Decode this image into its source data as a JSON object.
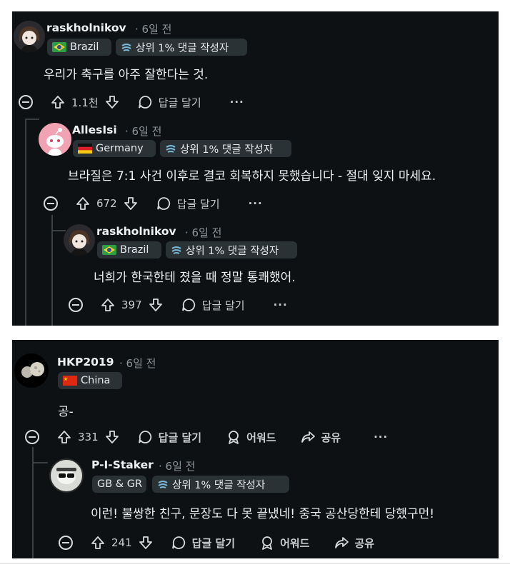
{
  "thread1": {
    "c1": {
      "username": "raskholnikov",
      "time": "· 6일 전",
      "flag": "Brazil",
      "badge": "상위 1% 댓글 작성자",
      "body": "우리가 축구를 아주 잘한다는 것.",
      "votes": "1.1천",
      "reply": "답글 달기",
      "more": "···"
    },
    "c2": {
      "username": "AllesIsi",
      "time": "· 6일 전",
      "flag": "Germany",
      "badge": "상위 1% 댓글 작성자",
      "body": "브라질은 7:1 사건 이후로 결코 회복하지 못했습니다 - 절대 잊지 마세요.",
      "votes": "672",
      "reply": "답글 달기",
      "more": "···"
    },
    "c3": {
      "username": "raskholnikov",
      "time": "· 6일 전",
      "flag": "Brazil",
      "badge": "상위 1% 댓글 작성자",
      "body": "너희가 한국한테 졌을 때 정말 통쾌했어.",
      "votes": "397",
      "reply": "답글 달기",
      "more": "···"
    }
  },
  "thread2": {
    "c1": {
      "username": "HKP2019",
      "time": "· 6일 전",
      "flag": "China",
      "body": "공-",
      "votes": "331",
      "reply": "답글 달기",
      "award": "어워드",
      "share": "공유",
      "more": "···"
    },
    "c2": {
      "username": "P-I-Staker",
      "time": "· 6일 전",
      "flag": "GB & GR",
      "badge": "상위 1% 댓글 작성자",
      "body": "이런! 불쌍한 친구, 문장도 다 못 끝냈네! 중국 공산당한테 당했구먼!",
      "votes": "241",
      "reply": "답글 달기",
      "award": "어워드",
      "share": "공유",
      "more": "···"
    }
  },
  "colors": {
    "background": "#0e1113",
    "flair": "#2a3236",
    "text": "#eef1f3",
    "muted": "#8b949a"
  },
  "icons": [
    "collapse-icon",
    "upvote-icon",
    "downvote-icon",
    "reply-bubble-icon",
    "award-icon",
    "share-icon",
    "more-icon"
  ]
}
